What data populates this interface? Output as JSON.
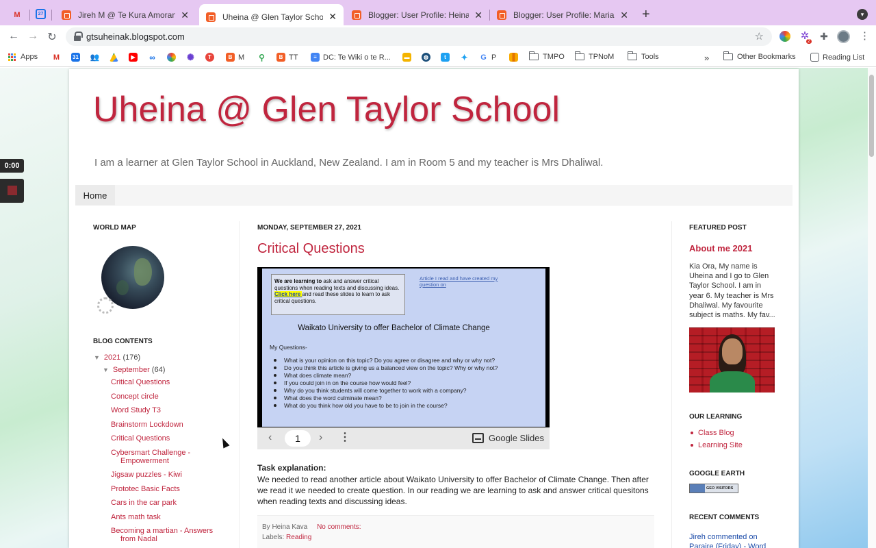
{
  "browser": {
    "tabs": [
      {
        "title": "Jireh M @ Te Kura Amorangi o",
        "active": false
      },
      {
        "title": "Uheina @ Glen Taylor School",
        "active": true
      },
      {
        "title": "Blogger: User Profile: Heina Ka",
        "active": false
      },
      {
        "title": "Blogger: User Profile: Maria Kr",
        "active": false
      }
    ],
    "pinned_calendar": "27",
    "url": "gtsuheinak.blogspot.com",
    "extension_badge": "2",
    "bookmarks": {
      "apps": "Apps",
      "m": "M",
      "tt": "TT",
      "dc": "DC: Te Wiki o te R...",
      "p": "P",
      "tmpo": "TMPO",
      "tpnom": "TPNoM",
      "tools": "Tools",
      "overflow": "»",
      "other": "Other Bookmarks",
      "reading": "Reading List"
    }
  },
  "recorder": {
    "time": "0:00"
  },
  "blog": {
    "title": "Uheina @ Glen Taylor School",
    "description": "I am a learner at Glen Taylor School in Auckland, New Zealand. I am in Room 5 and my teacher is Mrs Dhaliwal.",
    "nav_home": "Home"
  },
  "sidebar_left": {
    "world_map_heading": "WORLD MAP",
    "contents_heading": "BLOG CONTENTS",
    "year": "2021",
    "year_count": "(176)",
    "month": "September",
    "month_count": "(64)",
    "posts": [
      "Critical Questions",
      "Concept circle",
      "Word Study T3",
      "Brainstorm Lockdown",
      "Critical Questions",
      "Cybersmart Challenge -",
      "Empowerment",
      "Jigsaw puzzles - Kiwi",
      "Prototec Basic Facts",
      "Cars in the car park",
      "Ants math task",
      "Becoming a martian - Answers",
      "from Nadal"
    ]
  },
  "post": {
    "date": "MONDAY, SEPTEMBER 27, 2021",
    "title": "Critical Questions",
    "slide": {
      "lo_bold": "We are learning to",
      "lo_rest": " ask and answer critical questions when reading texts and discussing ideas.",
      "click_here": "Click here ",
      "click_rest": "and read these slides to learn to ask critical questions.",
      "link": "Article I read and have created my question on",
      "heading": "Waikato University to offer Bachelor of Climate Change",
      "questions_label": "My Questions-",
      "questions": [
        "What is your opinion on this topic? Do you agree or disagree and why or why not?",
        "Do you think this article is giving us a balanced view on the topic? Why or why not?",
        "What does climate mean?",
        "If you could join in on the course how would feel?",
        "Why do you think students will come together to work with a company?",
        "What does the word culminate mean?",
        "What do you think how old you have to be to join in the course?"
      ],
      "page": "1",
      "provider": "Google Slides"
    },
    "task_heading": "Task explanation:",
    "task_text": "We needed to read another article about Waikato University to offer Bachelor of Climate Change. Then after we read it we needed to create question. In our reading we are learning to ask and answer critical quesitons when reading texts and discussing ideas.",
    "by_prefix": "By",
    "author": "Heina Kava",
    "comments": "No comments:",
    "labels_prefix": "Labels:",
    "label": "Reading"
  },
  "sidebar_right": {
    "featured_heading": "FEATURED POST",
    "featured_title": "About me 2021",
    "featured_text": "Kia Ora, My name is Uheina and I go to Glen Taylor School. I am in year 6. My teacher is Mrs Dhaliwal. My favourite subject is maths. My fav...",
    "learning_heading": "OUR LEARNING",
    "learning_links": [
      "Class Blog",
      "Learning Site"
    ],
    "earth_heading": "GOOGLE EARTH",
    "geo_badge": "GEO VISITORS",
    "comments_heading": "RECENT COMMENTS",
    "recent_comment": "Jireh commented on Paraire (Friday) - Word"
  },
  "colors": {
    "accent": "#c0253e",
    "tab_bar": "#e6c8f2",
    "slide_bg": "#c6d3f3"
  }
}
